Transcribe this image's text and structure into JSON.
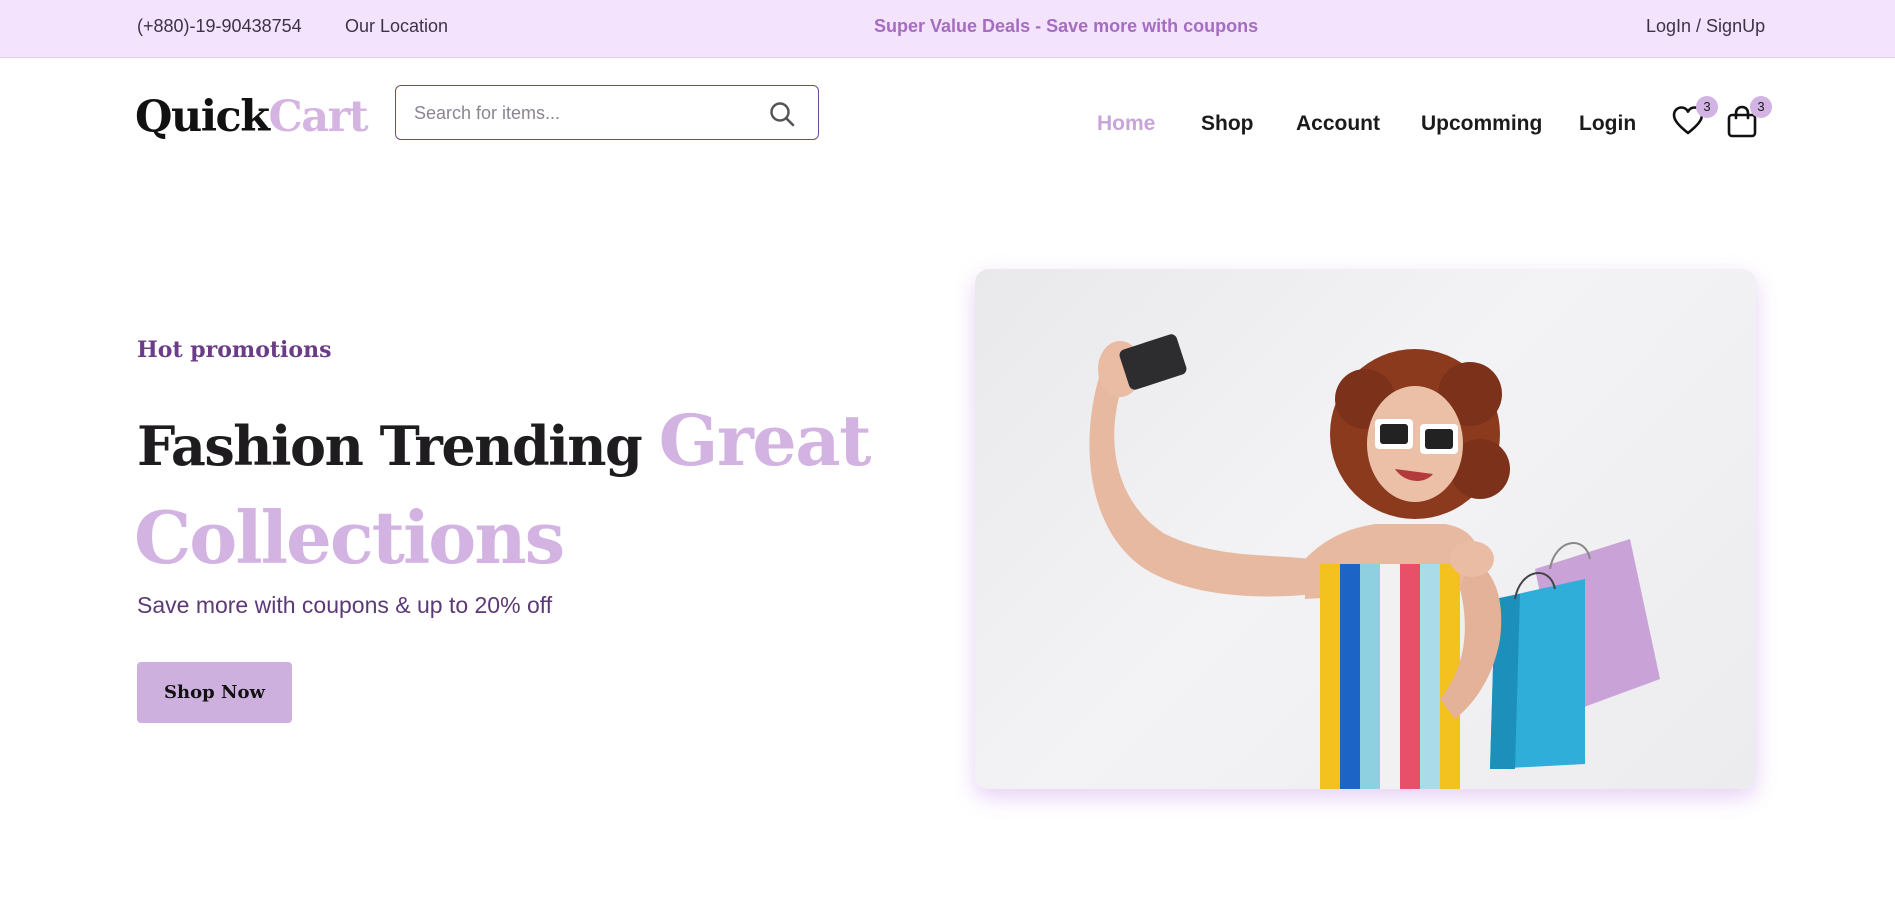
{
  "topbar": {
    "phone": "(+880)-19-90438754",
    "location": "Our Location",
    "deal": "Super Value Deals - Save more with coupons",
    "login_signup": "LogIn / SignUp"
  },
  "brand": {
    "part1": "Quick",
    "part2": "Cart"
  },
  "search": {
    "placeholder": "Search for items...",
    "value": ""
  },
  "nav": {
    "items": [
      {
        "label": "Home",
        "active": true
      },
      {
        "label": "Shop"
      },
      {
        "label": "Account"
      },
      {
        "label": "Upcomming"
      },
      {
        "label": "Login"
      }
    ]
  },
  "wishlist": {
    "count": "3",
    "icon": "heart-icon"
  },
  "cart": {
    "count": "3",
    "icon": "shopping-bag-icon"
  },
  "hero": {
    "eyebrow": "Hot promotions",
    "title_part1": "Fashion Trending",
    "title_accent1": "Great",
    "title_accent2": "Collections",
    "subtitle": "Save more with coupons & up to 20% off",
    "cta": "Shop Now"
  },
  "colors": {
    "topbar_bg": "#f3e3fc",
    "accent": "#d2b3e2",
    "deal_text": "#a56dc0",
    "dark_purple": "#6b3d86",
    "button_bg": "#cdb0dd"
  }
}
